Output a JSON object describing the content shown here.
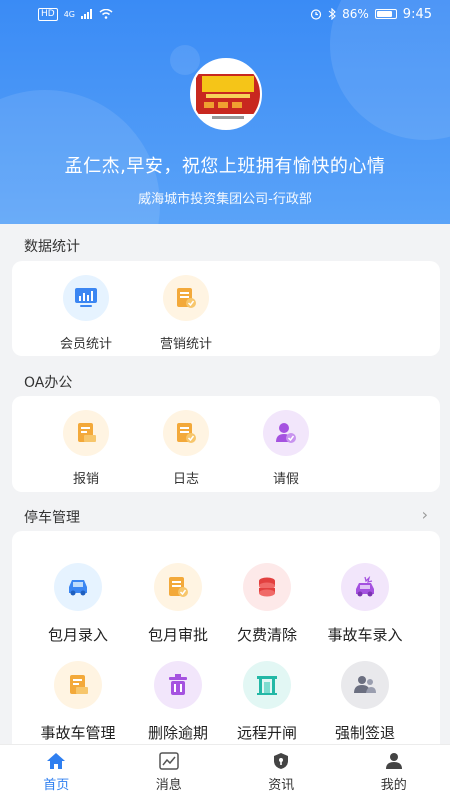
{
  "status": {
    "time": "9:45",
    "battery": "86%",
    "battery_level": 0.86,
    "hd": "HD",
    "signal": "4G"
  },
  "profile": {
    "greeting": "孟仁杰,早安，祝您上班拥有愉快的心情",
    "org": "威海城市投资集团公司-行政部"
  },
  "sections": {
    "stats": {
      "title": "数据统计",
      "items": [
        {
          "label": "会员统计",
          "icon": "monitor-chart-icon"
        },
        {
          "label": "营销统计",
          "icon": "document-check-icon"
        }
      ]
    },
    "oa": {
      "title": "OA办公",
      "items": [
        {
          "label": "报销",
          "icon": "receipt-icon"
        },
        {
          "label": "日志",
          "icon": "document-check-icon"
        },
        {
          "label": "请假",
          "icon": "user-badge-icon"
        }
      ]
    },
    "parking": {
      "title": "停车管理",
      "items": [
        {
          "label": "包月录入",
          "icon": "car-icon"
        },
        {
          "label": "包月审批",
          "icon": "document-check-icon"
        },
        {
          "label": "欠费清除",
          "icon": "coins-icon"
        },
        {
          "label": "事故车录入",
          "icon": "accident-car-icon"
        },
        {
          "label": "事故车管理",
          "icon": "receipt-icon"
        },
        {
          "label": "删除逾期",
          "icon": "trash-icon"
        },
        {
          "label": "远程开闸",
          "icon": "gate-icon"
        },
        {
          "label": "强制签退",
          "icon": "users-icon"
        }
      ]
    }
  },
  "tabs": [
    {
      "label": "首页",
      "icon": "home-icon",
      "active": true
    },
    {
      "label": "消息",
      "icon": "chart-icon",
      "active": false
    },
    {
      "label": "资讯",
      "icon": "shield-icon",
      "active": false
    },
    {
      "label": "我的",
      "icon": "person-icon",
      "active": false
    }
  ],
  "colors": {
    "brand": "#3a8bf5",
    "active_tab": "#2f7ff0"
  }
}
